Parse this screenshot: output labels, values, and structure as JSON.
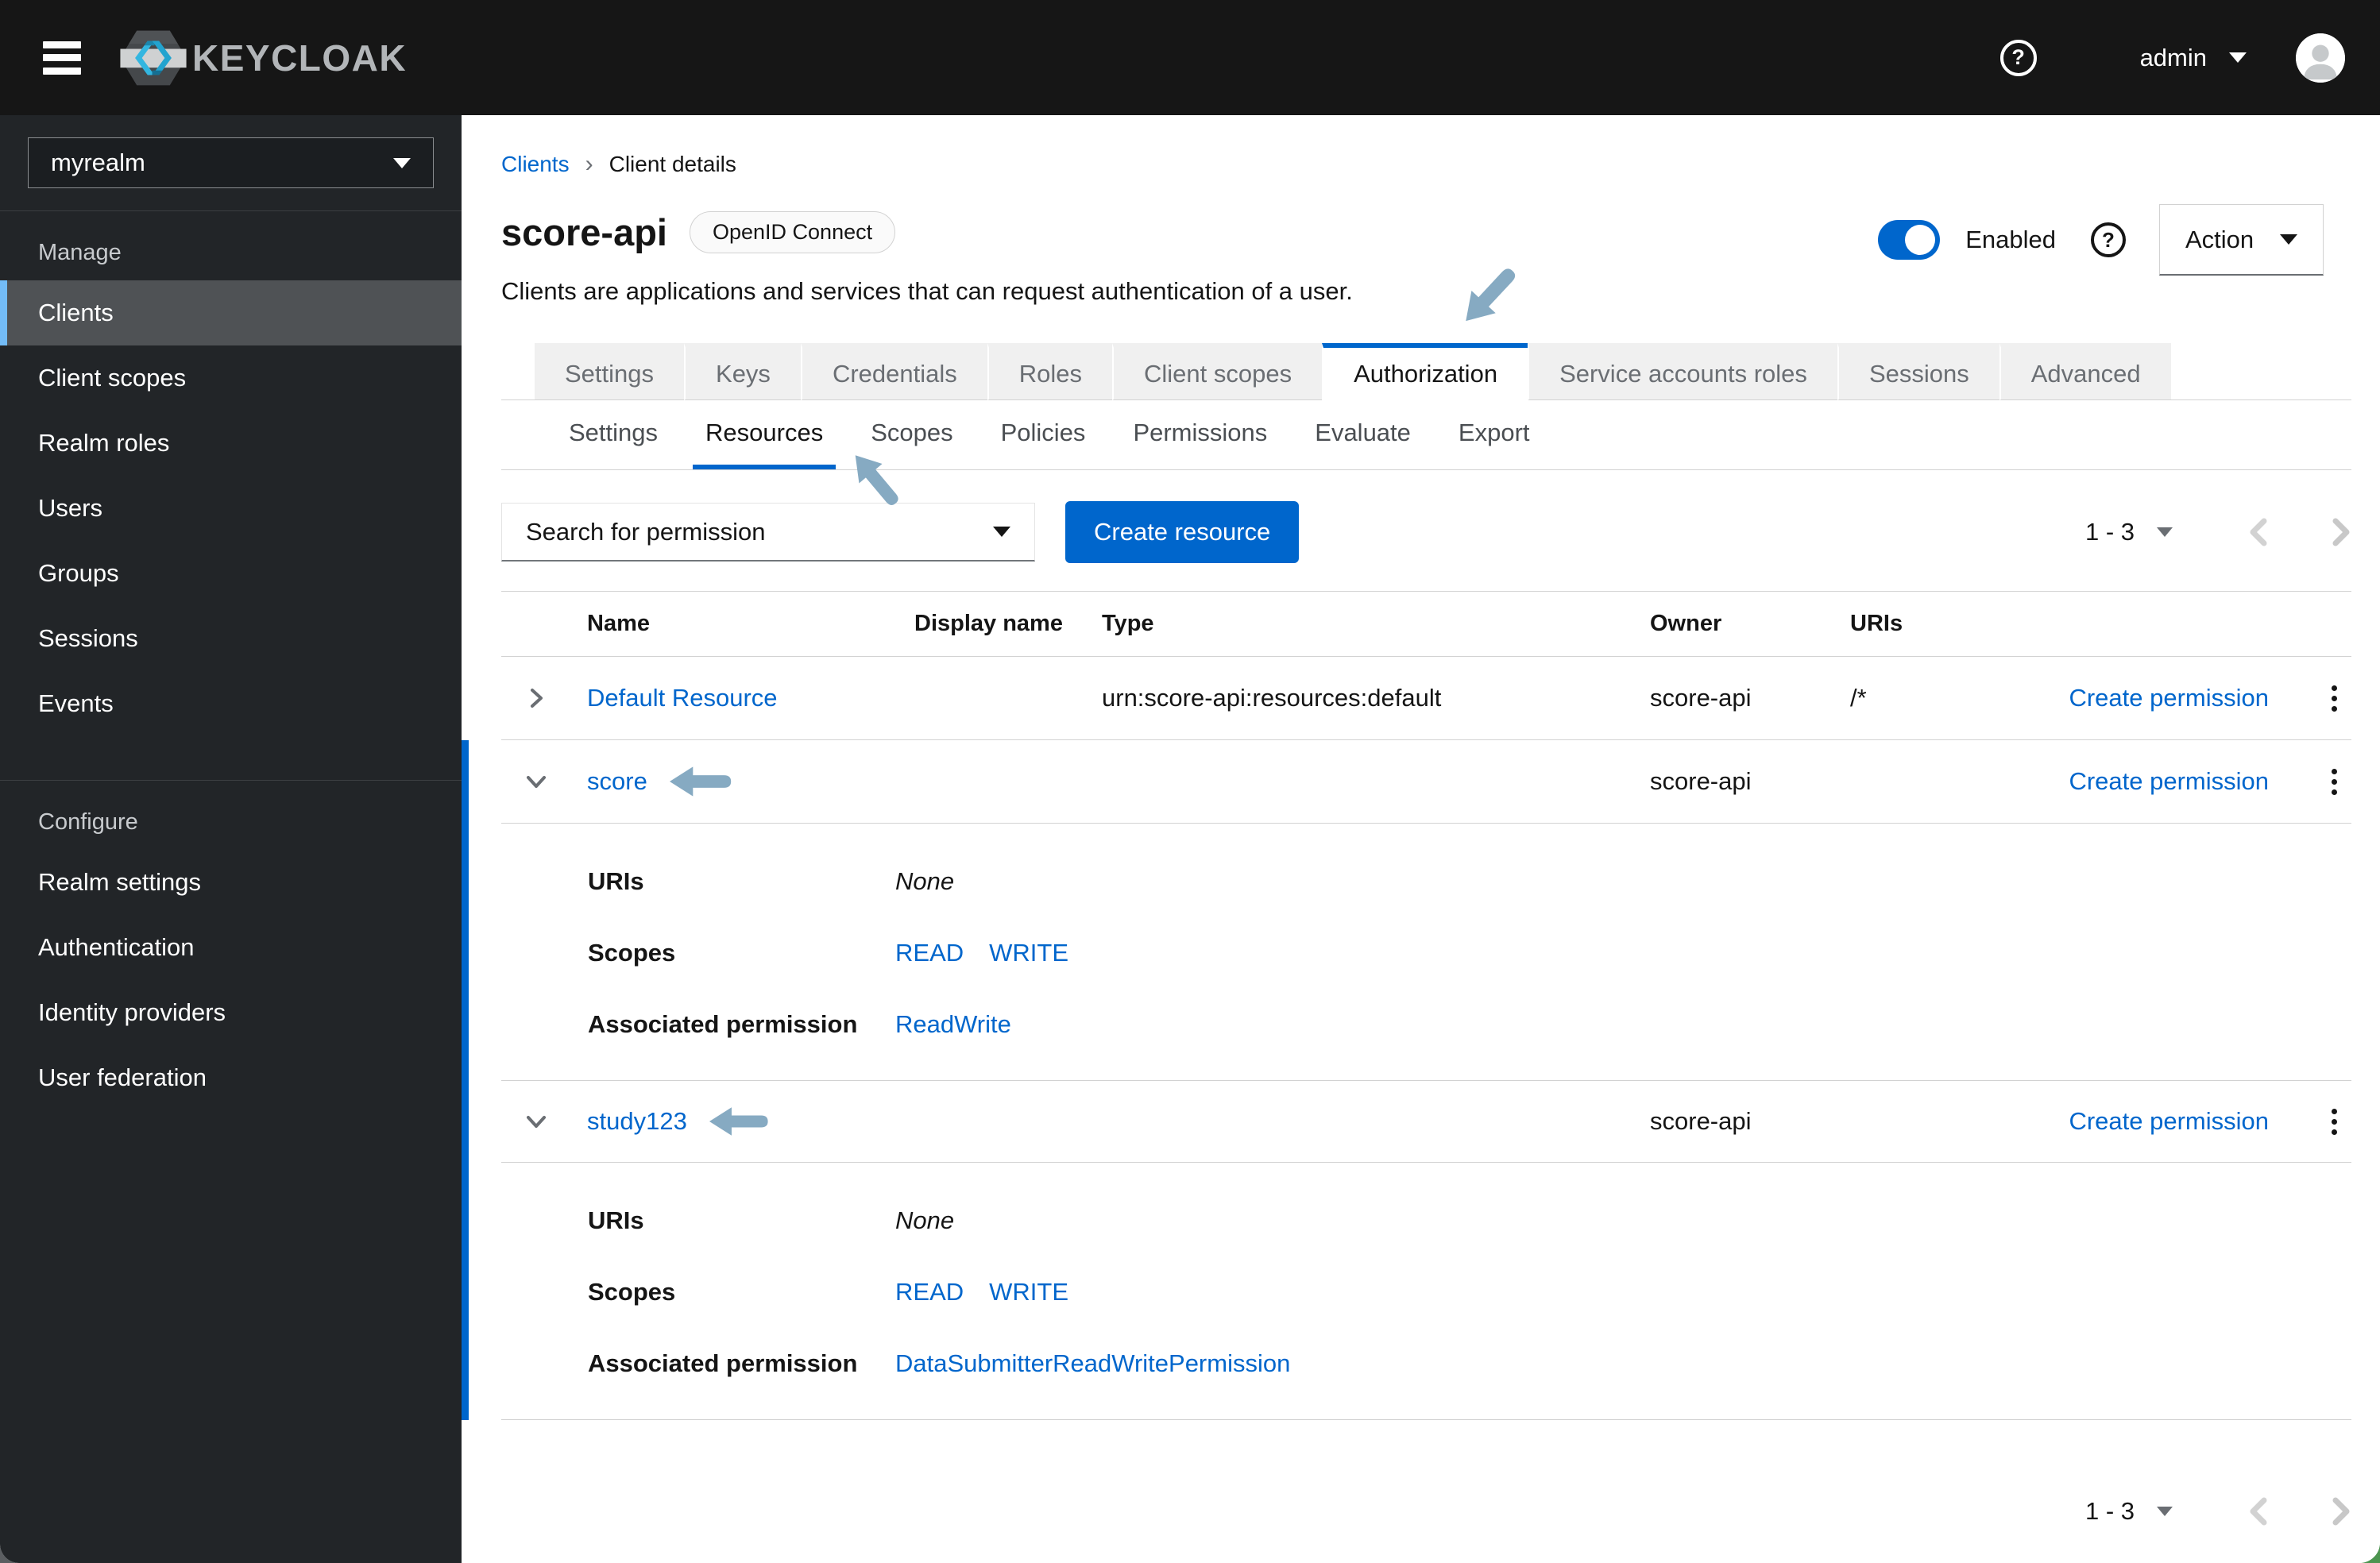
{
  "colors": {
    "accent": "#0066cc",
    "selected_indicator": "#73bcf7",
    "annotation_arrow": "#86aac2"
  },
  "masthead": {
    "brand": "KEYCLOAK",
    "username": "admin",
    "help_glyph": "?"
  },
  "sidebar": {
    "realm": "myrealm",
    "sections": [
      {
        "title": "Manage",
        "items": [
          "Clients",
          "Client scopes",
          "Realm roles",
          "Users",
          "Groups",
          "Sessions",
          "Events"
        ]
      },
      {
        "title": "Configure",
        "items": [
          "Realm settings",
          "Authentication",
          "Identity providers",
          "User federation"
        ]
      }
    ],
    "selected_item": "Clients"
  },
  "breadcrumb": {
    "parent": "Clients",
    "current": "Client details"
  },
  "page": {
    "title": "score-api",
    "protocol_badge": "OpenID Connect",
    "description": "Clients are applications and services that can request authentication of a user.",
    "enabled_label": "Enabled",
    "action_label": "Action",
    "help_glyph": "?"
  },
  "tabs": {
    "primary": [
      "Settings",
      "Keys",
      "Credentials",
      "Roles",
      "Client scopes",
      "Authorization",
      "Service accounts roles",
      "Sessions",
      "Advanced"
    ],
    "active_primary": "Authorization",
    "secondary": [
      "Settings",
      "Resources",
      "Scopes",
      "Policies",
      "Permissions",
      "Evaluate",
      "Export"
    ],
    "active_secondary": "Resources"
  },
  "toolbar": {
    "search_placeholder": "Search for permission",
    "create_button_label": "Create resource",
    "pagination_label": "1 - 3"
  },
  "table": {
    "columns": [
      "Name",
      "Display name",
      "Type",
      "Owner",
      "URIs"
    ],
    "rows": [
      {
        "name": "Default Resource",
        "display_name": "",
        "type": "urn:score-api:resources:default",
        "owner": "score-api",
        "uris": "/*",
        "action_label": "Create permission",
        "expanded": false
      },
      {
        "name": "score",
        "display_name": "",
        "type": "",
        "owner": "score-api",
        "uris": "",
        "action_label": "Create permission",
        "expanded": true,
        "details": {
          "uris_label": "URIs",
          "uris_value": "None",
          "scopes_label": "Scopes",
          "scopes": [
            "READ",
            "WRITE"
          ],
          "permission_label": "Associated permission",
          "permission_value": "ReadWrite"
        }
      },
      {
        "name": "study123",
        "display_name": "",
        "type": "",
        "owner": "score-api",
        "uris": "",
        "action_label": "Create permission",
        "expanded": true,
        "details": {
          "uris_label": "URIs",
          "uris_value": "None",
          "scopes_label": "Scopes",
          "scopes": [
            "READ",
            "WRITE"
          ],
          "permission_label": "Associated permission",
          "permission_value": "DataSubmitterReadWritePermission"
        }
      }
    ]
  },
  "footer": {
    "pagination_label": "1 - 3"
  }
}
